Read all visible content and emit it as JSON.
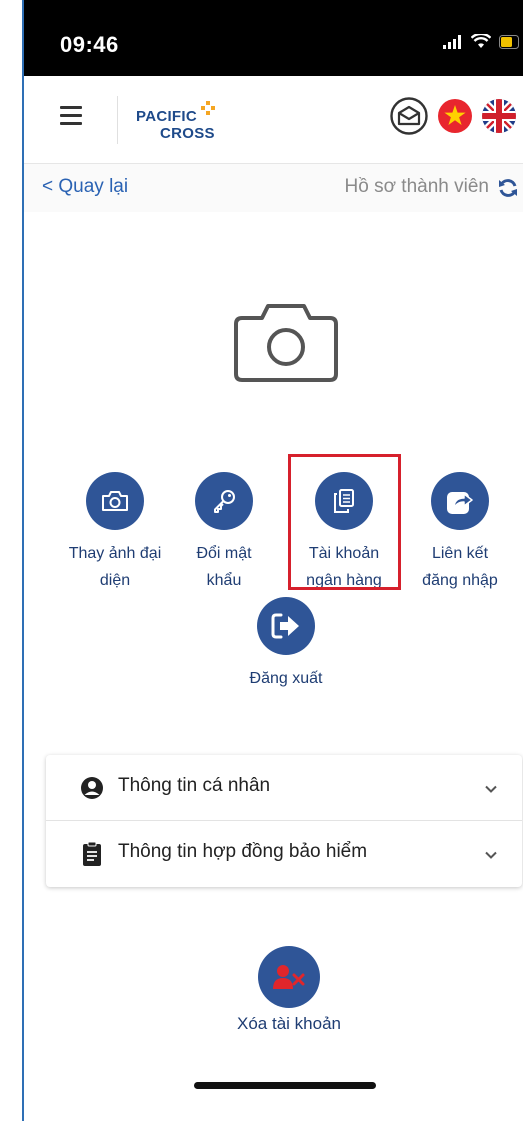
{
  "status_bar": {
    "time": "09:46"
  },
  "header": {
    "logo_line1": "PACIFIC",
    "logo_line2": "CROSS",
    "icons": [
      "menu-icon",
      "mail-icon",
      "vietnam-flag-icon",
      "uk-flag-icon"
    ]
  },
  "subheader": {
    "back_label": "< Quay lại",
    "title": "Hồ sơ thành viên"
  },
  "avatar": {
    "icon": "camera-icon"
  },
  "actions": [
    {
      "label_line1": "Thay ảnh đại",
      "label_line2": "diện",
      "icon": "camera-icon"
    },
    {
      "label_line1": "Đổi mật",
      "label_line2": "khẩu",
      "icon": "key-icon"
    },
    {
      "label_line1": "Tài khoản",
      "label_line2": "ngân hàng",
      "icon": "copy-icon"
    },
    {
      "label_line1": "Liên kết",
      "label_line2": "đăng nhập",
      "icon": "share-icon"
    },
    {
      "label_line1": "Đăng xuất",
      "icon": "logout-icon"
    }
  ],
  "accordion": [
    {
      "label": "Thông tin cá nhân",
      "icon": "user-circle-icon"
    },
    {
      "label": "Thông tin hợp đồng bảo hiểm",
      "icon": "clipboard-icon"
    }
  ],
  "delete_account": {
    "label": "Xóa tài khoản",
    "icon": "user-remove-icon"
  },
  "colors": {
    "primary": "#2f5597",
    "link": "#2a62b3",
    "highlight": "#d6202c",
    "delete_accent": "#e0262b"
  }
}
